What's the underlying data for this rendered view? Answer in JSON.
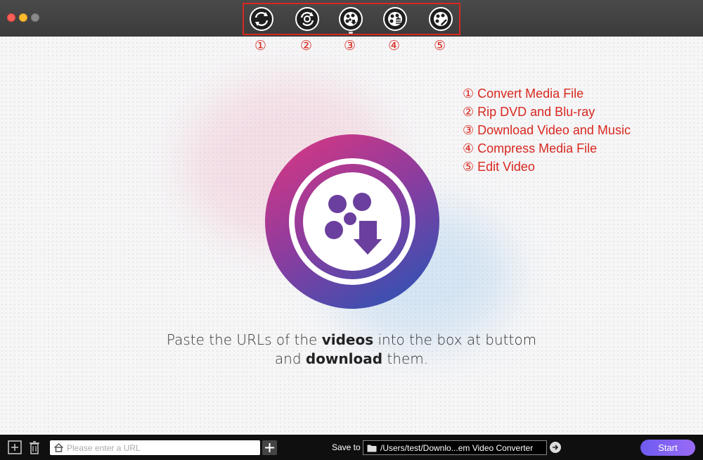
{
  "window": {
    "controls": [
      "close",
      "minimize",
      "maximize"
    ]
  },
  "toolbar": {
    "tools": [
      {
        "number": "①",
        "icon": "convert-icon",
        "label": "Convert Media File"
      },
      {
        "number": "②",
        "icon": "rip-dvd-icon",
        "label": "Rip DVD and Blu-ray"
      },
      {
        "number": "③",
        "icon": "download-video-icon",
        "label": "Download Video and Music"
      },
      {
        "number": "④",
        "icon": "compress-icon",
        "label": "Compress Media File"
      },
      {
        "number": "⑤",
        "icon": "edit-video-icon",
        "label": "Edit Video"
      }
    ],
    "highlight_color": "#d8281f"
  },
  "legend": {
    "items": [
      "① Convert Media File",
      "② Rip DVD and Blu-ray",
      "③ Download Video and Music",
      "④ Compress Media File",
      "⑤ Edit Video"
    ]
  },
  "main": {
    "hero_icon": "video-download-icon",
    "line1_pre": "Paste the URLs of the ",
    "line1_bold": "videos",
    "line1_post": " into the box at buttom",
    "line2_pre": "and ",
    "line2_bold": "download",
    "line2_post": " them."
  },
  "bottombar": {
    "url_placeholder": "Please enter a URL",
    "url_value": "",
    "save_label": "Save to",
    "save_path": "/Users/test/Downlo...em Video Converter",
    "start_label": "Start",
    "accent": "#7a62f2"
  }
}
